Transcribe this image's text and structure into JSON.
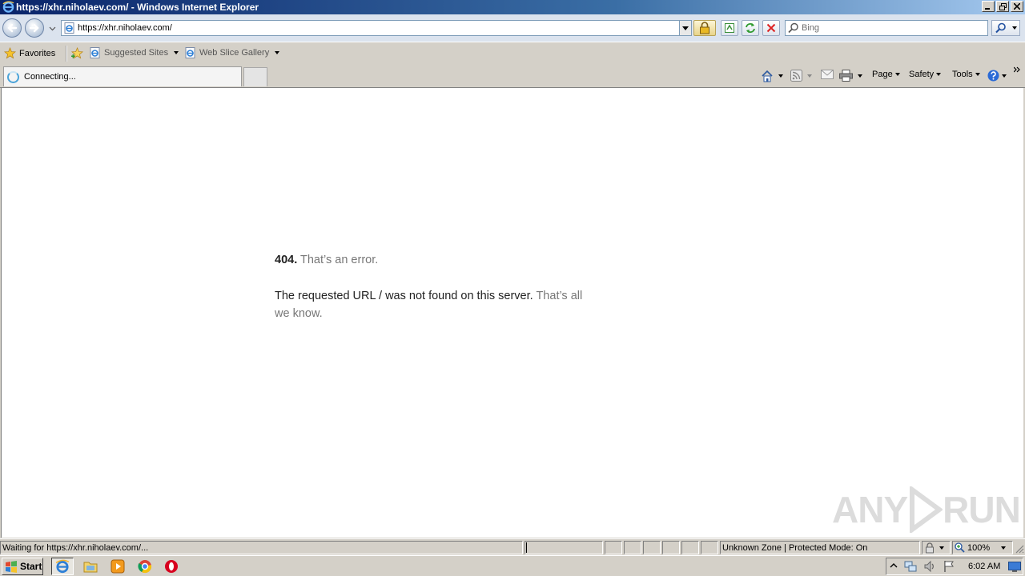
{
  "window": {
    "title": "https://xhr.niholaev.com/ - Windows Internet Explorer"
  },
  "address_bar": {
    "url": "https://xhr.niholaev.com/"
  },
  "search": {
    "placeholder": "Bing"
  },
  "favorites_bar": {
    "favorites_label": "Favorites",
    "items": [
      {
        "label": "Suggested Sites"
      },
      {
        "label": "Web Slice Gallery"
      }
    ]
  },
  "tab": {
    "label": "Connecting..."
  },
  "command_bar": {
    "page_label": "Page",
    "safety_label": "Safety",
    "tools_label": "Tools"
  },
  "page": {
    "error_code": "404.",
    "error_title": "That’s an error.",
    "message": "The requested URL / was not found on this server.",
    "message_muted": "That’s all we know."
  },
  "watermark": {
    "text_left": "ANY",
    "text_right": "RUN"
  },
  "status_bar": {
    "status_text": "Waiting for https://xhr.niholaev.com/...",
    "progress_percent": 1,
    "zone_text": "Unknown Zone | Protected Mode: On",
    "zoom": "100%"
  },
  "taskbar": {
    "start_label": "Start",
    "clock": "6:02 AM"
  },
  "colors": {
    "chrome_bg": "#d4d0c8",
    "title_bar": "#0a246a",
    "error_text": "#222222",
    "muted_text": "#777777"
  }
}
